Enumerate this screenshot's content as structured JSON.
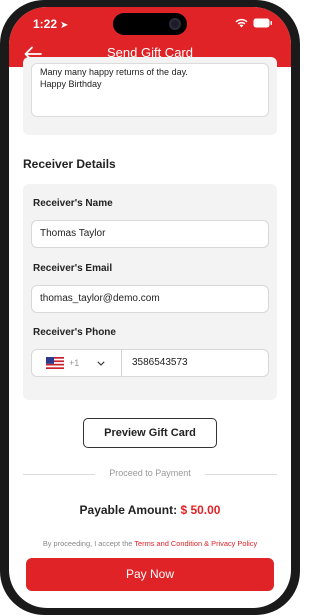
{
  "status_bar": {
    "time": "1:22"
  },
  "header": {
    "title": "Send Gift Card"
  },
  "message": {
    "lines": [
      "Many many happy returns of the day.",
      "Happy Birthday"
    ]
  },
  "receiver": {
    "section_title": "Receiver Details",
    "name_label": "Receiver's Name",
    "name_value": "Thomas Taylor",
    "email_label": "Receiver's Email",
    "email_value": "thomas_taylor@demo.com",
    "phone_label": "Receiver's Phone",
    "dial_code": "+1",
    "phone_value": "3586543573"
  },
  "actions": {
    "preview_label": "Preview Gift Card",
    "divider_text": "Proceed to Payment",
    "payable_label": "Payable Amount:",
    "payable_amount": "$ 50.00",
    "terms_prefix": "By proceeding, I accept the ",
    "terms_link": "Terms and Condition & Privacy Policy",
    "pay_label": "Pay Now"
  },
  "colors": {
    "accent": "#e02327",
    "card_bg": "#f3f3f3"
  }
}
